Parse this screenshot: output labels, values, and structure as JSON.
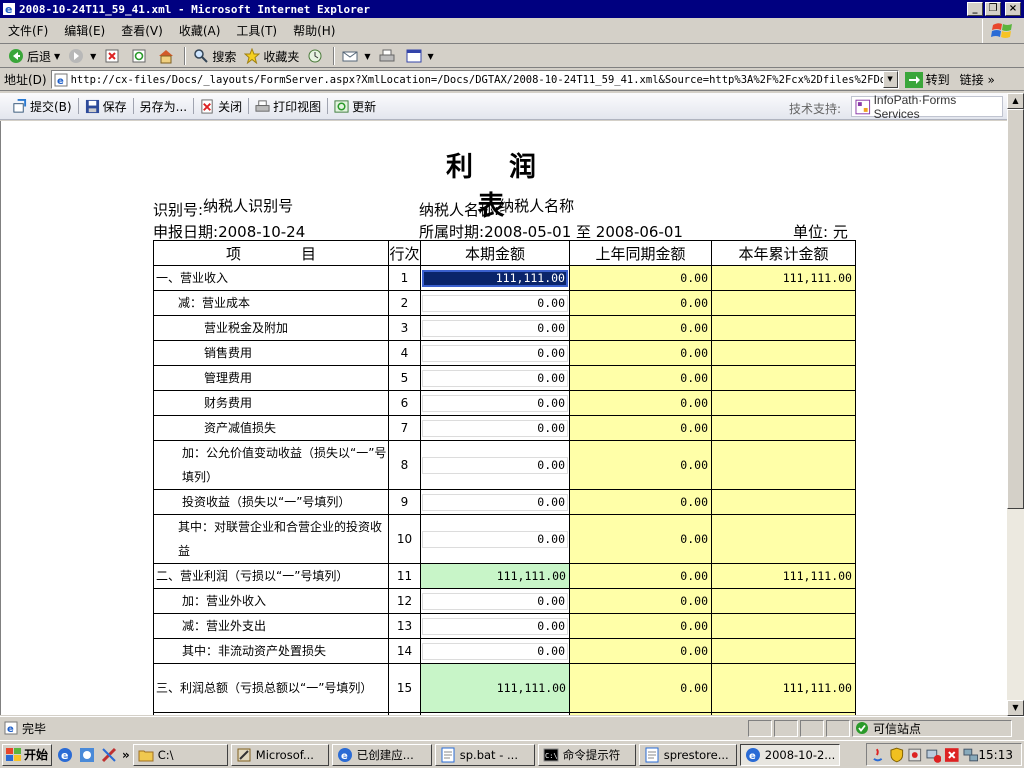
{
  "window": {
    "title": "2008-10-24T11_59_41.xml - Microsoft Internet Explorer"
  },
  "menu": [
    "文件(F)",
    "编辑(E)",
    "查看(V)",
    "收藏(A)",
    "工具(T)",
    "帮助(H)"
  ],
  "toolbar": {
    "back": "后退",
    "search": "搜索",
    "favorites": "收藏夹"
  },
  "address": {
    "label": "地址(D)",
    "url": "http://cx-files/Docs/_layouts/FormServer.aspx?XmlLocation=/Docs/DGTAX/2008-10-24T11_59_41.xml&Source=http%3A%2F%2Fcx%2Dfiles%2FDocs%2FDG",
    "go": "转到",
    "links": "链接"
  },
  "forms_toolbar": {
    "submit": "提交(B)",
    "save": "保存",
    "save_as": "另存为...",
    "close": "关闭",
    "print_view": "打印视图",
    "update": "更新",
    "tech_support": "技术支持:",
    "logo_text": "InfoPath·Forms Services"
  },
  "form": {
    "title": "利润表",
    "tax_id_label": "识别号:",
    "tax_id_value": "纳税人识别号",
    "taxpayer_label": "纳税人名称:",
    "taxpayer_value": "纳税人名称",
    "date_label": "申报日期:",
    "date_value": "2008-10-24",
    "period_label": "所属时期:",
    "period_value": "2008-05-01 至 2008-06-01",
    "unit": "单位: 元",
    "columns": [
      "项　　　　目",
      "行次",
      "本期金额",
      "上年同期金额",
      "本年累计金额"
    ],
    "rows": [
      {
        "item": "一、营业收入",
        "no": "1",
        "current": "111,111.00",
        "prev": "0.00",
        "ytd": "111,111.00"
      },
      {
        "item": "减：营业成本",
        "no": "2",
        "current": "0.00",
        "prev": "0.00",
        "ytd": ""
      },
      {
        "item": "营业税金及附加",
        "no": "3",
        "current": "0.00",
        "prev": "0.00",
        "ytd": ""
      },
      {
        "item": "销售费用",
        "no": "4",
        "current": "0.00",
        "prev": "0.00",
        "ytd": ""
      },
      {
        "item": "管理费用",
        "no": "5",
        "current": "0.00",
        "prev": "0.00",
        "ytd": ""
      },
      {
        "item": "财务费用",
        "no": "6",
        "current": "0.00",
        "prev": "0.00",
        "ytd": ""
      },
      {
        "item": "资产减值损失",
        "no": "7",
        "current": "0.00",
        "prev": "0.00",
        "ytd": ""
      },
      {
        "item": "加：公允价值变动收益（损失以“一”号填列）",
        "no": "8",
        "current": "0.00",
        "prev": "0.00",
        "ytd": ""
      },
      {
        "item": "投资收益（损失以“一”号填列）",
        "no": "9",
        "current": "0.00",
        "prev": "0.00",
        "ytd": ""
      },
      {
        "item": "其中：对联营企业和合营企业的投资收益",
        "no": "10",
        "current": "0.00",
        "prev": "0.00",
        "ytd": ""
      },
      {
        "item": "二、营业利润（亏损以“一”号填列）",
        "no": "11",
        "current": "111,111.00",
        "prev": "0.00",
        "ytd": "111,111.00"
      },
      {
        "item": "加：营业外收入",
        "no": "12",
        "current": "0.00",
        "prev": "0.00",
        "ytd": ""
      },
      {
        "item": "减：营业外支出",
        "no": "13",
        "current": "0.00",
        "prev": "0.00",
        "ytd": ""
      },
      {
        "item": "其中：非流动资产处置损失",
        "no": "14",
        "current": "0.00",
        "prev": "0.00",
        "ytd": ""
      },
      {
        "item": "三、利润总额（亏损总额以“一”号填列）",
        "no": "15",
        "current": "111,111.00",
        "prev": "0.00",
        "ytd": "111,111.00"
      }
    ]
  },
  "status": {
    "text": "完毕",
    "zone": "可信站点"
  },
  "taskbar": {
    "start": "开始",
    "tasks": [
      "C:\\",
      "Microsof...",
      "已创建应...",
      "sp.bat - ...",
      "命令提示符",
      "sprestore...",
      "2008-10-2..."
    ],
    "clock": "15:13"
  },
  "colors": {
    "title_bar": "#000080",
    "readonly_yellow": "#ffffa8",
    "calculated_green": "#c8f5c8"
  }
}
